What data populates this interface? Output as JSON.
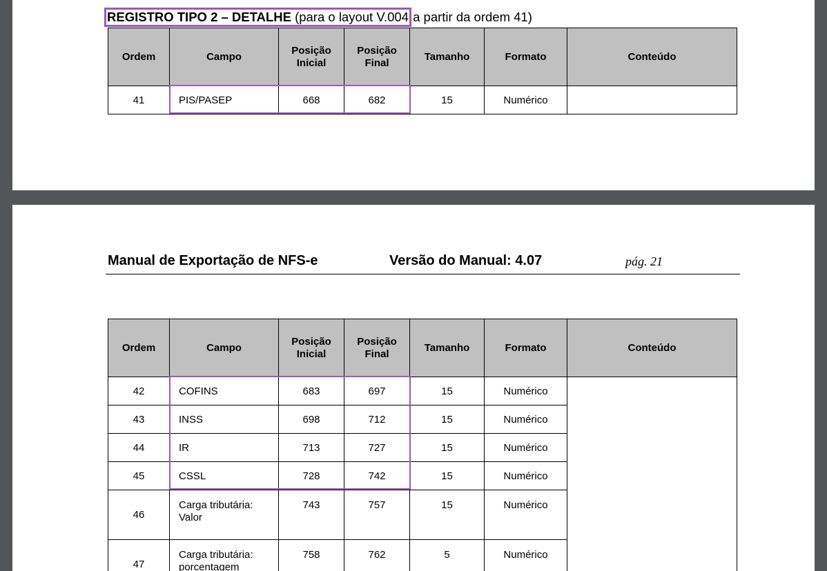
{
  "top_section": {
    "heading_bold": "REGISTRO TIPO 2 – DETALHE",
    "heading_paren": "(para o layout V.004",
    "heading_rest": " a partir da ordem 41)"
  },
  "columns": [
    "Ordem",
    "Campo",
    "Posição Inicial",
    "Posição Final",
    "Tamanho",
    "Formato",
    "Conteúdo"
  ],
  "column_parts": {
    "pi_line1": "Posição",
    "pi_line2": "Inicial",
    "pf_line1": "Posição",
    "pf_line2": "Final"
  },
  "table1_rows": [
    {
      "ordem": "41",
      "campo": "PIS/PASEP",
      "pos_inicial": "668",
      "pos_final": "682",
      "tamanho": "15",
      "formato": "Numérico",
      "conteudo": ""
    }
  ],
  "manual_header": {
    "title": "Manual de Exportação de NFS-e",
    "version": "Versão do Manual: 4.07",
    "page": "pág. 21"
  },
  "table2_rows": [
    {
      "ordem": "42",
      "campo": "COFINS",
      "pos_inicial": "683",
      "pos_final": "697",
      "tamanho": "15",
      "formato": "Numérico"
    },
    {
      "ordem": "43",
      "campo": "INSS",
      "pos_inicial": "698",
      "pos_final": "712",
      "tamanho": "15",
      "formato": "Numérico"
    },
    {
      "ordem": "44",
      "campo": "IR",
      "pos_inicial": "713",
      "pos_final": "727",
      "tamanho": "15",
      "formato": "Numérico"
    },
    {
      "ordem": "45",
      "campo": "CSSL",
      "pos_inicial": "728",
      "pos_final": "742",
      "tamanho": "15",
      "formato": "Numérico"
    },
    {
      "ordem": "46",
      "campo_line1": "Carga tributária:",
      "campo_line2": "Valor",
      "pos_inicial": "743",
      "pos_final": "757",
      "tamanho": "15",
      "formato": "Numérico"
    },
    {
      "ordem": "47",
      "campo_line1": "Carga tributária:",
      "campo_line2": "porcentagem",
      "pos_inicial": "758",
      "pos_final": "762",
      "tamanho": "5",
      "formato": "Numérico"
    }
  ],
  "colors": {
    "highlight": "#9b59b6",
    "header_bg": "#c0c0c0",
    "viewer_bg": "#525659"
  }
}
